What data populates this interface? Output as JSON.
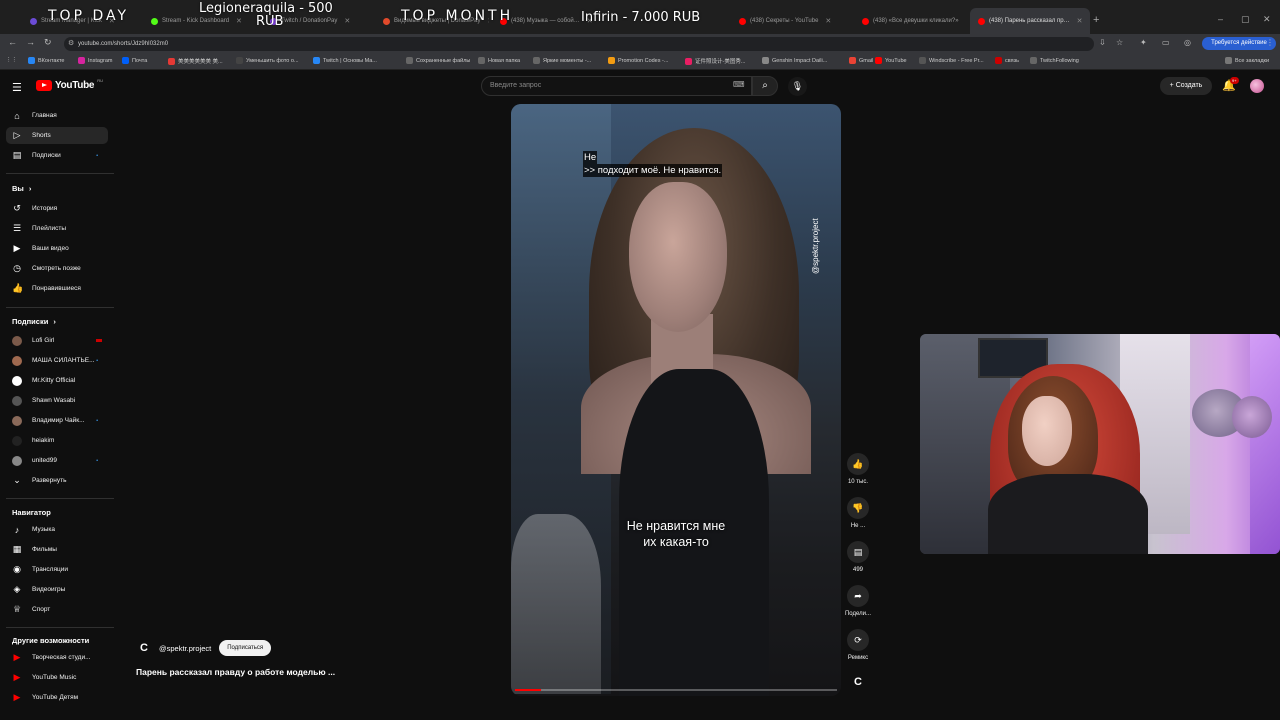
{
  "browser": {
    "tabs": [
      {
        "label": "Stream Manager | Kick",
        "fav": "#6b4bd6",
        "active": false
      },
      {
        "label": "Stream - Kick Dashboard",
        "fav": "#53fc18",
        "active": false
      },
      {
        "label": "Twitch / DonationPay",
        "fav": "#9146ff",
        "active": false
      },
      {
        "label": "Видимые виджеты | DonatePay",
        "fav": "#e24a2b",
        "active": false
      },
      {
        "label": "(438) Музыка — собой…",
        "fav": "#ff0000",
        "active": false
      },
      {
        "label": "(438) Секреты - YouTube",
        "fav": "#ff0000",
        "active": false
      },
      {
        "label": "(438) «Все девушки кликали?»",
        "fav": "#ff0000",
        "active": false
      },
      {
        "label": "(438) Парень рассказал пр…",
        "fav": "#ff0000",
        "active": true
      }
    ],
    "url": "youtube.com/shorts/Jdz9hI032m0",
    "action_required": "Требуется действие",
    "bookmarks": [
      {
        "label": "ВКонтакте",
        "color": "#2787f5"
      },
      {
        "label": "Instagram",
        "color": "#d6249f"
      },
      {
        "label": "Почта",
        "color": "#005ff9"
      },
      {
        "label": "美美美美美美 美...",
        "color": "#e53935"
      },
      {
        "label": "Уменьшить фото о...",
        "color": "#444"
      },
      {
        "label": "Twitch | Основы Ма...",
        "color": "#2787f5"
      },
      {
        "label": "Сохраненные файлы",
        "color": "#666"
      },
      {
        "label": "Новая папка",
        "color": "#666"
      },
      {
        "label": "Яркие моменты -...",
        "color": "#666"
      },
      {
        "label": "Promotion Codes -...",
        "color": "#f39c12"
      },
      {
        "label": "证件照设计-美图秀...",
        "color": "#e91e63"
      },
      {
        "label": "Genshin Impact Daili...",
        "color": "#888"
      },
      {
        "label": "Gmail",
        "color": "#ea4335"
      },
      {
        "label": "YouTube",
        "color": "#ff0000"
      },
      {
        "label": "Windscribe - Free Pr...",
        "color": "#555"
      },
      {
        "label": "связь",
        "color": "#cc0000"
      },
      {
        "label": "TwitchFollowing",
        "color": "#666"
      }
    ],
    "bookmarks_all": "Все закладки"
  },
  "overlay": {
    "top_day": "TOP DAY",
    "day_donor": "Legioneraquila - 500",
    "day_currency": "RUB",
    "top_month": "TOP MONTH",
    "month_donor": "Infirin - 7.000 RUB"
  },
  "youtube": {
    "logo_text": "YouTube",
    "logo_region": "RU",
    "search_placeholder": "Введите запрос",
    "create_label": "Создать",
    "notif_count": "9+",
    "sidebar": {
      "main": [
        {
          "label": "Главная",
          "icon": "⌂",
          "selected": false
        },
        {
          "label": "Shorts",
          "icon": "▷",
          "selected": true
        },
        {
          "label": "Подписки",
          "icon": "▤",
          "selected": false
        }
      ],
      "you_header": "Вы",
      "you": [
        {
          "label": "История",
          "icon": "↺"
        },
        {
          "label": "Плейлисты",
          "icon": "☰"
        },
        {
          "label": "Ваши видео",
          "icon": "▶"
        },
        {
          "label": "Смотреть позже",
          "icon": "◷"
        },
        {
          "label": "Понравившиеся",
          "icon": "👍"
        }
      ],
      "subs_header": "Подписки",
      "subs": [
        {
          "label": "Lofi Girl",
          "color": "#7b5a4a"
        },
        {
          "label": "МАША СИЛАНТЬЕ...",
          "color": "#a06a50"
        },
        {
          "label": "Mr.Kitty Official",
          "color": "#ffffff"
        },
        {
          "label": "Shawn Wasabi",
          "color": "#555"
        },
        {
          "label": "Владимир Чайк...",
          "color": "#8a6a5a"
        },
        {
          "label": "heiakim",
          "color": "#222"
        },
        {
          "label": "united99",
          "color": "#888"
        }
      ],
      "expand_label": "Развернуть",
      "nav_header": "Навигатор",
      "nav": [
        {
          "label": "Музыка",
          "icon": "♪"
        },
        {
          "label": "Фильмы",
          "icon": "▦"
        },
        {
          "label": "Трансляции",
          "icon": "◉"
        },
        {
          "label": "Видеоигры",
          "icon": "◈"
        },
        {
          "label": "Спорт",
          "icon": "♕"
        }
      ],
      "more_header": "Другие возможности",
      "more": [
        {
          "label": "Творческая студи..."
        },
        {
          "label": "YouTube Music"
        },
        {
          "label": "YouTube Детям"
        }
      ]
    },
    "short": {
      "caption_top_line1": "Не",
      "caption_top_line2": ">> подходит моё. Не нравится.",
      "caption_mid_line1": "Не нравится мне",
      "caption_mid_line2": "их какая-то",
      "watermark": "@spektr.project",
      "channel": "@spektr.project",
      "subscribe": "Подписаться",
      "title": "Парень рассказал правду о работе моделью ...",
      "progress": 0.08,
      "likes": "10 тыс.",
      "dislike_label": "Не ...",
      "comments": "499",
      "share_label": "Подели...",
      "remix_label": "Ремикс"
    }
  }
}
